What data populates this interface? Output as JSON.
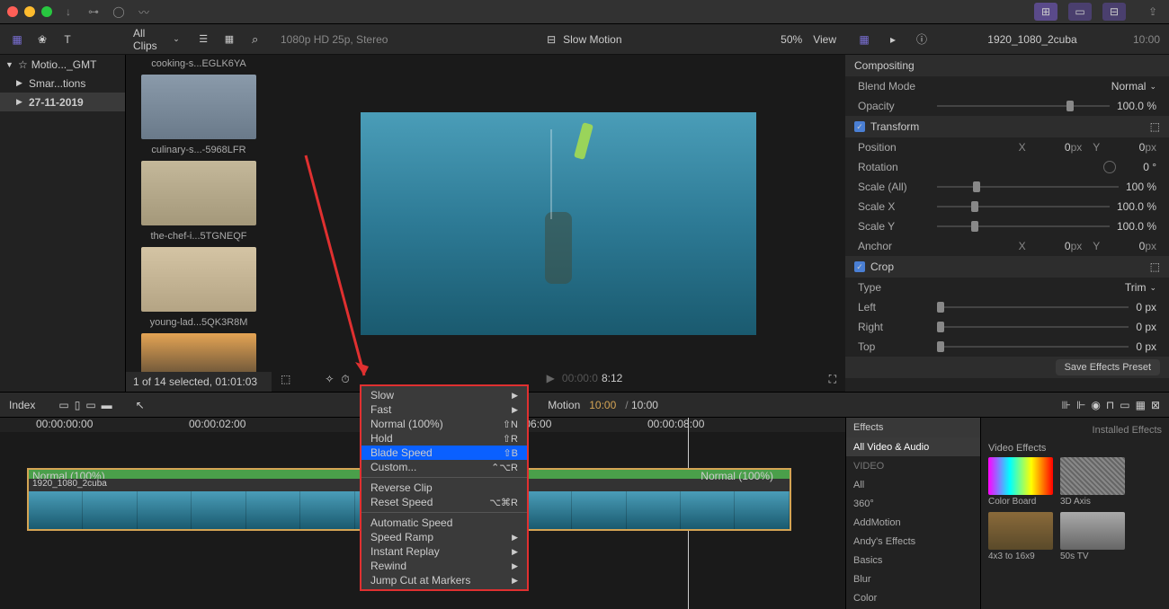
{
  "titlebar": {},
  "toolbar": {
    "clips_filter": "All Clips",
    "format_info": "1080p HD 25p, Stereo",
    "project_name": "Slow Motion",
    "zoom": "50%",
    "view": "View",
    "clip_name": "1920_1080_2cuba",
    "duration": "10:00"
  },
  "sidebar": {
    "items": [
      {
        "label": "Motio..._GMT",
        "expanded": true,
        "selected": false
      },
      {
        "label": "Smar...tions",
        "expanded": false,
        "selected": false
      },
      {
        "label": "27-11-2019",
        "expanded": false,
        "selected": true
      }
    ]
  },
  "browser": {
    "clips": [
      {
        "label": "cooking-s...EGLK6YA"
      },
      {
        "label": "culinary-s...-5968LFR"
      },
      {
        "label": "the-chef-i...5TGNEQF"
      },
      {
        "label": "young-lad...5QK3R8M"
      }
    ],
    "footer": "1 of 14 selected, 01:01:03"
  },
  "viewer": {
    "timecode": "8:12",
    "timecode_prefix": "00:00:0"
  },
  "timeline": {
    "index_label": "Index",
    "project_title": "Motion",
    "current_time": "10:00",
    "total_time": "10:00",
    "ticks": [
      "00:00:00:00",
      "00:00:02:00",
      "",
      "00:00:06:00",
      "00:00:08:00"
    ],
    "clip": {
      "name": "1920_1080_2cuba",
      "speed_left": "Normal (100%)",
      "speed_right": "Normal (100%)"
    }
  },
  "context_menu": {
    "items": [
      {
        "label": "Slow",
        "submenu": true
      },
      {
        "label": "Fast",
        "submenu": true
      },
      {
        "label": "Normal (100%)",
        "shortcut": "⇧N"
      },
      {
        "label": "Hold",
        "shortcut": "⇧R"
      },
      {
        "label": "Blade Speed",
        "shortcut": "⇧B",
        "selected": true
      },
      {
        "label": "Custom...",
        "shortcut": "⌃⌥R"
      },
      {
        "sep": true
      },
      {
        "label": "Reverse Clip",
        "disabled": true
      },
      {
        "label": "Reset Speed",
        "shortcut": "⌥⌘R"
      },
      {
        "sep": true
      },
      {
        "label": "Automatic Speed"
      },
      {
        "label": "Speed Ramp",
        "submenu": true
      },
      {
        "label": "Instant Replay",
        "submenu": true
      },
      {
        "label": "Rewind",
        "submenu": true
      },
      {
        "label": "Jump Cut at Markers",
        "submenu": true
      }
    ]
  },
  "inspector": {
    "sections": {
      "compositing": {
        "title": "Compositing",
        "blend_mode_label": "Blend Mode",
        "blend_mode_value": "Normal",
        "opacity_label": "Opacity",
        "opacity_value": "100.0 %"
      },
      "transform": {
        "title": "Transform",
        "position_label": "Position",
        "position_x": "0",
        "position_y": "0",
        "unit": "px",
        "rotation_label": "Rotation",
        "rotation_value": "0 °",
        "scale_all_label": "Scale (All)",
        "scale_all_value": "100 %",
        "scale_x_label": "Scale X",
        "scale_x_value": "100.0 %",
        "scale_y_label": "Scale Y",
        "scale_y_value": "100.0 %",
        "anchor_label": "Anchor",
        "anchor_x": "0",
        "anchor_y": "0"
      },
      "crop": {
        "title": "Crop",
        "type_label": "Type",
        "type_value": "Trim",
        "left_label": "Left",
        "left_value": "0 px",
        "right_label": "Right",
        "right_value": "0 px",
        "top_label": "Top",
        "top_value": "0 px"
      }
    },
    "save_preset": "Save Effects Preset"
  },
  "effects": {
    "header": "Effects",
    "installed": "Installed Effects",
    "categories": [
      "All Video & Audio",
      "VIDEO",
      "All",
      "360°",
      "AddMotion",
      "Andy's Effects",
      "Basics",
      "Blur",
      "Color"
    ],
    "grid_header": "Video Effects",
    "thumbs": [
      {
        "label": "Color Board"
      },
      {
        "label": "3D Axis"
      },
      {
        "label": "4x3 to 16x9"
      },
      {
        "label": "50s TV"
      }
    ]
  }
}
